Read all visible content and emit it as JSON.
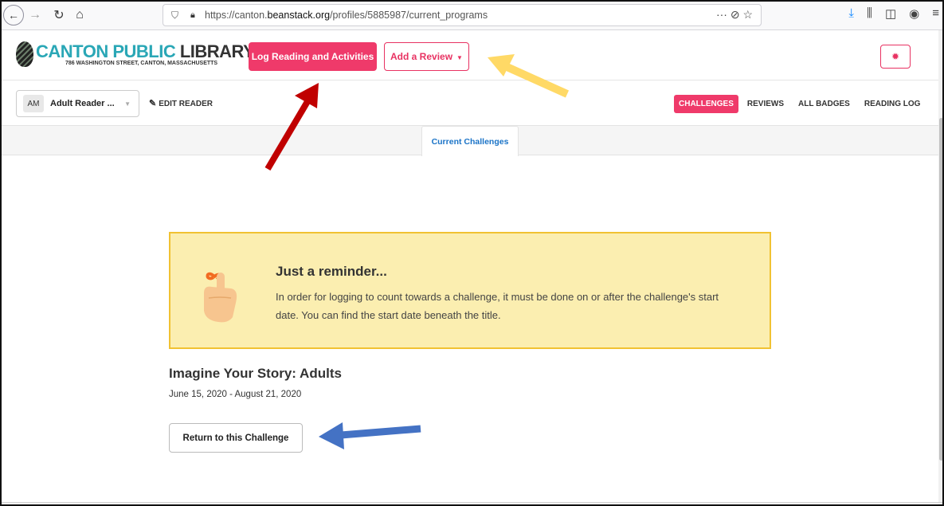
{
  "browser": {
    "url_prefix": "https://canton.",
    "url_domain": "beanstack.org",
    "url_path": "/profiles/5885987/current_programs",
    "url_actions": "··· ⊘ ☆"
  },
  "header": {
    "logo_part1": "CANTON PUBLIC ",
    "logo_part2": "LIBRARY",
    "logo_address": "786 WASHINGTON STREET, CANTON, MASSACHUSETTS",
    "log_button": "Log Reading and Activities",
    "review_button": "Add a Review"
  },
  "subheader": {
    "avatar": "AM",
    "reader_name": "Adult Reader ...",
    "edit_reader": "EDIT READER",
    "tabs": [
      "CHALLENGES",
      "REVIEWS",
      "ALL BADGES",
      "READING LOG"
    ]
  },
  "tab_strip": {
    "current_tab": "Current Challenges"
  },
  "reminder": {
    "title": "Just a reminder...",
    "text": "In order for logging to count towards a challenge, it must be done on or after the challenge's start date. You can find the start date beneath the title."
  },
  "challenge": {
    "title": "Imagine Your Story: Adults",
    "dates": "June 15, 2020 - August 21, 2020",
    "return_button": "Return to this Challenge"
  },
  "colors": {
    "brand_pink": "#ef3a6a",
    "logo_teal": "#2aa7b6",
    "reminder_bg": "#fbeeb0",
    "reminder_border": "#f1c232",
    "arrow_red": "#c00000",
    "arrow_yellow": "#ffd966",
    "arrow_blue": "#4472c4"
  }
}
